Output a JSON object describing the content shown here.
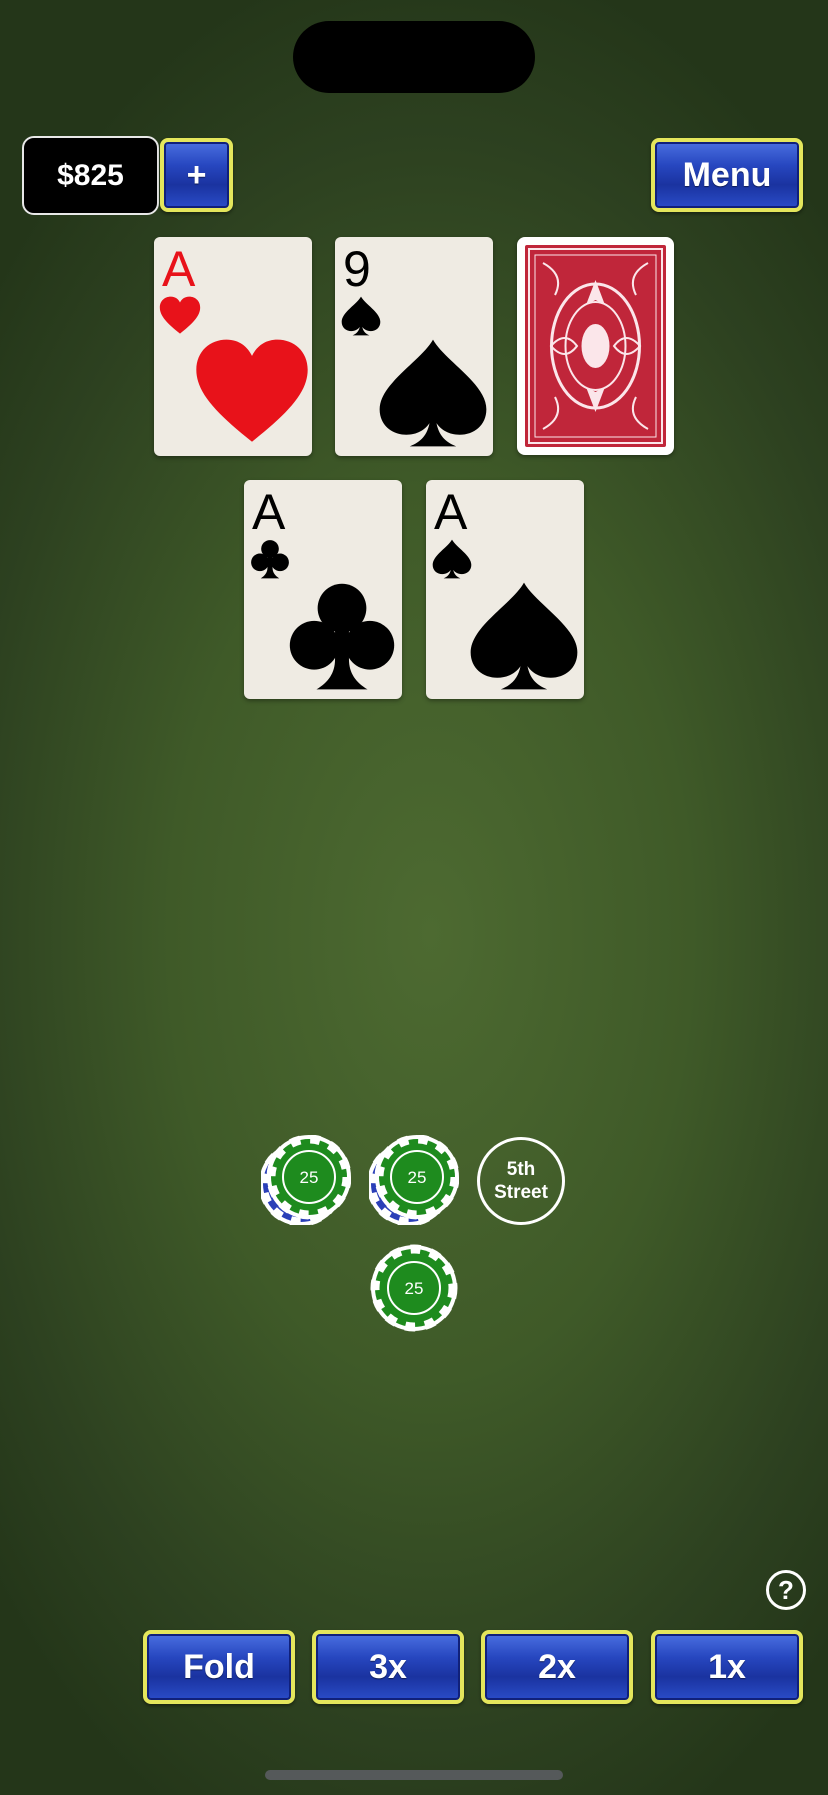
{
  "header": {
    "balance": "$825",
    "add_funds_label": "+",
    "menu_label": "Menu"
  },
  "dealer_cards": [
    {
      "rank": "A",
      "suit": "hearts",
      "color": "red"
    },
    {
      "rank": "9",
      "suit": "spades",
      "color": "black"
    },
    {
      "face_down": true
    }
  ],
  "player_cards": [
    {
      "rank": "A",
      "suit": "clubs",
      "color": "black"
    },
    {
      "rank": "A",
      "suit": "spades",
      "color": "black"
    }
  ],
  "bets": {
    "chips": [
      {
        "value": "25",
        "stack": 2
      },
      {
        "value": "25",
        "stack": 2
      },
      {
        "value": "25",
        "stack": 1
      }
    ],
    "marker_line1": "5th",
    "marker_line2": "Street"
  },
  "help_label": "?",
  "actions": {
    "fold": "Fold",
    "x3": "3x",
    "x2": "2x",
    "x1": "1x"
  },
  "colors": {
    "felt": "#4d6a31",
    "button_blue": "#2747c0",
    "button_border": "#e4e65c",
    "chip_green": "#1e8b1e",
    "card_red": "#e8121a",
    "card_back_red": "#c0263a"
  }
}
